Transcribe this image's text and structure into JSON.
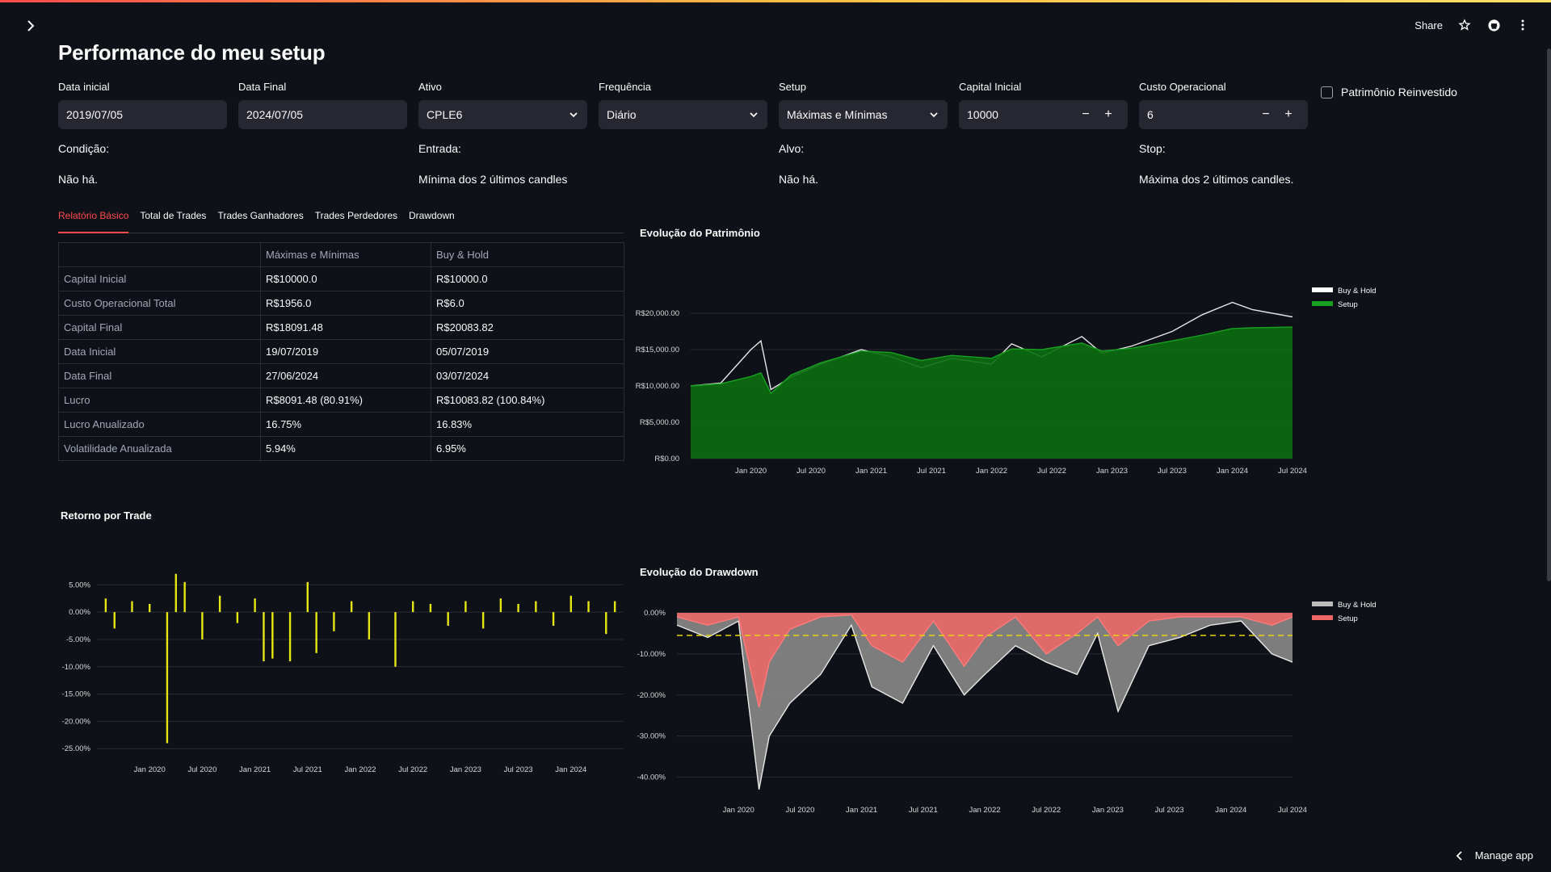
{
  "app": {
    "title": "Performance do meu setup",
    "share_label": "Share",
    "manage_label": "Manage app",
    "icons": [
      "chevron-right-icon",
      "star-icon",
      "github-icon",
      "more-vert-icon",
      "chevron-left-icon"
    ]
  },
  "form": {
    "data_inicial": {
      "label": "Data inicial",
      "value": "2019/07/05"
    },
    "data_final": {
      "label": "Data Final",
      "value": "2024/07/05"
    },
    "ativo": {
      "label": "Ativo",
      "value": "CPLE6"
    },
    "frequencia": {
      "label": "Frequência",
      "value": "Diário"
    },
    "setup": {
      "label": "Setup",
      "value": "Máximas e Mínimas"
    },
    "capital_inicial": {
      "label": "Capital Inicial",
      "value": "10000"
    },
    "custo_operacional": {
      "label": "Custo Operacional",
      "value": "6"
    },
    "reinvestido": {
      "label": "Patrimônio Reinvestido",
      "checked": false
    }
  },
  "info": {
    "condicao_label": "Condição:",
    "condicao_value": "Não há.",
    "entrada_label": "Entrada:",
    "entrada_value": "Mínima dos 2 últimos candles",
    "alvo_label": "Alvo:",
    "alvo_value": "Não há.",
    "stop_label": "Stop:",
    "stop_value": "Máxima dos 2 últimos candles."
  },
  "tabs": [
    "Relatório Básico",
    "Total de Trades",
    "Trades Ganhadores",
    "Trades Perdedores",
    "Drawdown"
  ],
  "report": {
    "headers": [
      "",
      "Máximas e Mínimas",
      "Buy & Hold"
    ],
    "rows": [
      [
        "Capital Inicial",
        "R$10000.0",
        "R$10000.0"
      ],
      [
        "Custo Operacional Total",
        "R$1956.0",
        "R$6.0"
      ],
      [
        "Capital Final",
        "R$18091.48",
        "R$20083.82"
      ],
      [
        "Data Inicial",
        "19/07/2019",
        "05/07/2019"
      ],
      [
        "Data Final",
        "27/06/2024",
        "03/07/2024"
      ],
      [
        "Lucro",
        "R$8091.48 (80.91%)",
        "R$10083.82 (100.84%)"
      ],
      [
        "Lucro Anualizado",
        "16.75%",
        "16.83%"
      ],
      [
        "Volatilidade Anualizada",
        "5.94%",
        "6.95%"
      ]
    ]
  },
  "colors": {
    "accent": "#ff4b4b",
    "setup_equity": "#0a6e10",
    "buy_hold": "#ffffff",
    "setup_dd": "#f06666",
    "buyhold_dd": "#8a8a8a",
    "trade_bar": "#e6e612",
    "dd_mean_line": "#e6d60e"
  },
  "chart_data": [
    {
      "id": "equity",
      "type": "area",
      "title": "Evolução do Patrimônio",
      "x_ticks": [
        "Jan 2020",
        "Jul 2020",
        "Jan 2021",
        "Jul 2021",
        "Jan 2022",
        "Jul 2022",
        "Jan 2023",
        "Jul 2023",
        "Jan 2024",
        "Jul 2024"
      ],
      "y_ticks": [
        "R$0.00",
        "R$5,000.00",
        "R$10,000.00",
        "R$15,000.00",
        "R$20,000.00"
      ],
      "ylim": [
        0,
        22000
      ],
      "legend": [
        "Buy & Hold",
        "Setup"
      ],
      "legend_position": "top-right",
      "series": [
        {
          "name": "Buy & Hold",
          "x": [
            "2019-07",
            "2019-10",
            "2020-01",
            "2020-02",
            "2020-03",
            "2020-05",
            "2020-08",
            "2020-12",
            "2021-03",
            "2021-06",
            "2021-09",
            "2022-01",
            "2022-03",
            "2022-06",
            "2022-10",
            "2022-12",
            "2023-03",
            "2023-07",
            "2023-10",
            "2024-01",
            "2024-03",
            "2024-07"
          ],
          "y": [
            10000,
            10400,
            15000,
            16200,
            9500,
            11200,
            13000,
            15000,
            14000,
            12500,
            13800,
            13000,
            15800,
            14000,
            16800,
            14500,
            15500,
            17500,
            19800,
            21500,
            20500,
            19500
          ]
        },
        {
          "name": "Setup",
          "x": [
            "2019-07",
            "2019-10",
            "2020-01",
            "2020-02",
            "2020-03",
            "2020-05",
            "2020-08",
            "2020-12",
            "2021-03",
            "2021-06",
            "2021-09",
            "2022-01",
            "2022-03",
            "2022-06",
            "2022-10",
            "2022-12",
            "2023-03",
            "2023-07",
            "2023-10",
            "2024-01",
            "2024-03",
            "2024-07"
          ],
          "y": [
            10000,
            10300,
            11300,
            11800,
            9000,
            11500,
            13200,
            14800,
            14600,
            13500,
            14200,
            13800,
            15100,
            15000,
            15900,
            14800,
            15200,
            16200,
            17000,
            17900,
            18000,
            18100
          ]
        }
      ]
    },
    {
      "id": "returns",
      "type": "bar",
      "title": "Retorno por Trade",
      "x_ticks": [
        "Jan 2020",
        "Jul 2020",
        "Jan 2021",
        "Jul 2021",
        "Jan 2022",
        "Jul 2022",
        "Jan 2023",
        "Jul 2023",
        "Jan 2024"
      ],
      "y_ticks": [
        "5.00%",
        "0.00%",
        "-5.00%",
        "-10.00%",
        "-15.00%",
        "-20.00%",
        "-25.00%"
      ],
      "ylim": [
        -26,
        8
      ],
      "x": [
        "2019-08",
        "2019-09",
        "2019-11",
        "2020-01",
        "2020-03",
        "2020-04",
        "2020-05",
        "2020-07",
        "2020-09",
        "2020-11",
        "2021-01",
        "2021-02",
        "2021-03",
        "2021-05",
        "2021-07",
        "2021-08",
        "2021-10",
        "2021-12",
        "2022-02",
        "2022-05",
        "2022-07",
        "2022-09",
        "2022-11",
        "2023-01",
        "2023-03",
        "2023-05",
        "2023-07",
        "2023-09",
        "2023-11",
        "2024-01",
        "2024-03",
        "2024-05",
        "2024-06"
      ],
      "values": [
        2.5,
        -3.0,
        2.0,
        1.5,
        -24.0,
        7.0,
        5.5,
        -5.0,
        3.0,
        -2.0,
        2.5,
        -9.0,
        -8.5,
        -9.0,
        5.5,
        -7.5,
        -3.5,
        2.0,
        -5.0,
        -10.0,
        2.0,
        1.5,
        -2.5,
        2.0,
        -3.0,
        2.5,
        1.5,
        2.0,
        -2.5,
        3.0,
        2.0,
        -4.0,
        2.0
      ]
    },
    {
      "id": "drawdown",
      "type": "area",
      "title": "Evolução do Drawdown",
      "x_ticks": [
        "Jan 2020",
        "Jul 2020",
        "Jan 2021",
        "Jul 2021",
        "Jan 2022",
        "Jul 2022",
        "Jan 2023",
        "Jul 2023",
        "Jan 2024",
        "Jul 2024"
      ],
      "y_ticks": [
        "0.00%",
        "-10.00%",
        "-20.00%",
        "-30.00%",
        "-40.00%"
      ],
      "ylim": [
        -45,
        0
      ],
      "legend": [
        "Buy & Hold",
        "Setup"
      ],
      "legend_position": "top-right",
      "reference_line": -5.5,
      "series": [
        {
          "name": "Buy & Hold",
          "x": [
            "2019-07",
            "2019-10",
            "2020-01",
            "2020-03",
            "2020-04",
            "2020-06",
            "2020-09",
            "2020-12",
            "2021-02",
            "2021-05",
            "2021-08",
            "2021-11",
            "2022-01",
            "2022-04",
            "2022-07",
            "2022-10",
            "2022-12",
            "2023-02",
            "2023-05",
            "2023-08",
            "2023-11",
            "2024-02",
            "2024-05",
            "2024-07"
          ],
          "y": [
            -3,
            -6,
            -2,
            -43,
            -30,
            -22,
            -15,
            -3,
            -18,
            -22,
            -8,
            -20,
            -15,
            -8,
            -12,
            -15,
            -5,
            -24,
            -8,
            -6,
            -3,
            -2,
            -10,
            -12
          ]
        },
        {
          "name": "Setup",
          "x": [
            "2019-07",
            "2019-10",
            "2020-01",
            "2020-03",
            "2020-04",
            "2020-06",
            "2020-09",
            "2020-12",
            "2021-02",
            "2021-05",
            "2021-08",
            "2021-11",
            "2022-01",
            "2022-04",
            "2022-07",
            "2022-10",
            "2022-12",
            "2023-02",
            "2023-05",
            "2023-08",
            "2023-11",
            "2024-02",
            "2024-05",
            "2024-07"
          ],
          "y": [
            -1,
            -3,
            -1,
            -23,
            -12,
            -4,
            -1,
            -0.5,
            -8,
            -12,
            -2,
            -13,
            -6,
            -1,
            -10,
            -5,
            -1,
            -8,
            -2,
            -1,
            -1,
            -1,
            -3,
            -1
          ]
        }
      ]
    }
  ]
}
